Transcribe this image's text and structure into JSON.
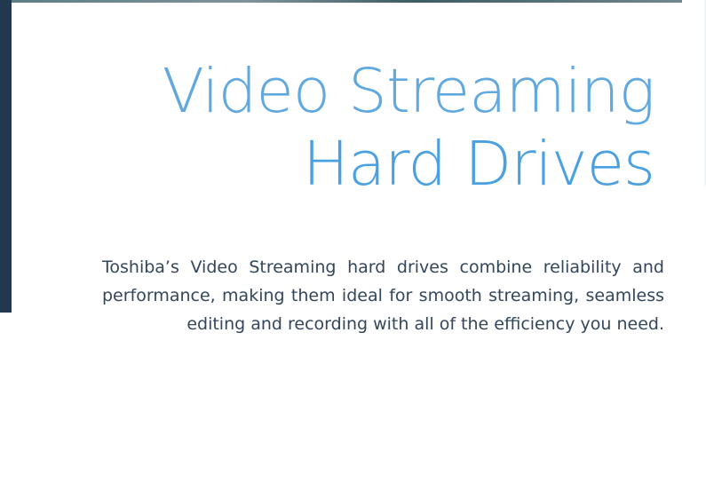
{
  "hero": {
    "title_line_1": "Video Streaming",
    "title_line_2": "Hard Drives",
    "description": "Toshiba’s Video Streaming hard drives combine reliability and performance, making them ideal for smooth streaming, seamless editing and recording with all of the efficiency you need."
  },
  "colors": {
    "title_accent": "#61a8df",
    "text_dark": "#33465b",
    "side_bar": "#22384f"
  }
}
